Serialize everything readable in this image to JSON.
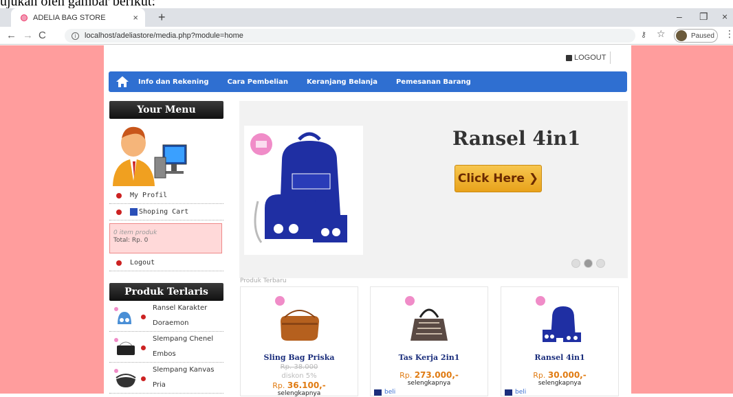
{
  "caption": "ujukan oleh gambar berikut:",
  "browser": {
    "tab_title": "ADELIA BAG STORE",
    "tab_close": "×",
    "new_tab": "+",
    "url": "localhost/adeliastore/media.php?module=home",
    "profile_status": "Paused",
    "window_min": "–",
    "window_restore": "❐",
    "window_close": "×"
  },
  "header": {
    "logout": "LOGOUT"
  },
  "menu": {
    "items": [
      "Info dan Rekening",
      "Cara Pembelian",
      "Keranjang Belanja",
      "Pemesanan Barang"
    ]
  },
  "sidebar": {
    "your_menu": "Your Menu",
    "my_profil": "My Profil",
    "shopping_cart": "Shoping Cart",
    "cart_items": "0 item produk",
    "cart_total": "Total: Rp. 0",
    "logout": "Logout",
    "best_sellers_title": "Produk Terlaris",
    "best_sellers": [
      {
        "line1": "Ransel Karakter",
        "line2": "Doraemon"
      },
      {
        "line1": "Slempang Chenel",
        "line2": "Embos"
      },
      {
        "line1": "Slempang Kanvas",
        "line2": "Pria"
      }
    ]
  },
  "slider": {
    "title": "Ransel 4in1",
    "button": "Click Here ❯",
    "dots": 3,
    "active_dot": 2
  },
  "products": {
    "section_label": "Produk Terbaru",
    "items": [
      {
        "name": "Sling Bag Priska",
        "old_price": "Rp. 38.000",
        "discount": "diskon 5%",
        "price_prefix": "Rp.",
        "price": "36.100,-",
        "more": "selengkapnya"
      },
      {
        "name": "Tas Kerja 2in1",
        "price_prefix": "Rp.",
        "price": "273.000,-",
        "more": "selengkapnya",
        "buy": "beli"
      },
      {
        "name": "Ransel 4in1",
        "price_prefix": "Rp.",
        "price": "30.000,-",
        "more": "selengkapnya",
        "buy": "beli"
      }
    ]
  },
  "colors": {
    "page_bg": "#ff9d9d",
    "menu_bar": "#2f6fd1",
    "price": "#e07b12",
    "product_name": "#1b2e7c"
  }
}
